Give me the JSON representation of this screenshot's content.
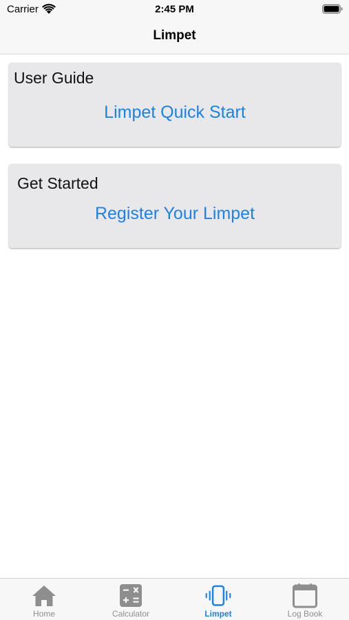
{
  "status_bar": {
    "carrier": "Carrier",
    "time": "2:45 PM"
  },
  "nav": {
    "title": "Limpet"
  },
  "cards": [
    {
      "heading": "User Guide",
      "link_label": "Limpet Quick Start"
    },
    {
      "heading": "Get Started",
      "link_label": "Register Your Limpet"
    }
  ],
  "tab_bar": {
    "items": [
      {
        "label": "Home",
        "icon": "home-icon",
        "active": false
      },
      {
        "label": "Calculator",
        "icon": "calculator-icon",
        "active": false
      },
      {
        "label": "Limpet",
        "icon": "phone-vibrate-icon",
        "active": true
      },
      {
        "label": "Log Book",
        "icon": "calendar-icon",
        "active": false
      }
    ]
  },
  "colors": {
    "accent": "#1a82e8",
    "inactive_tab": "#8e8e8e",
    "card_background": "#e8e8ea"
  }
}
